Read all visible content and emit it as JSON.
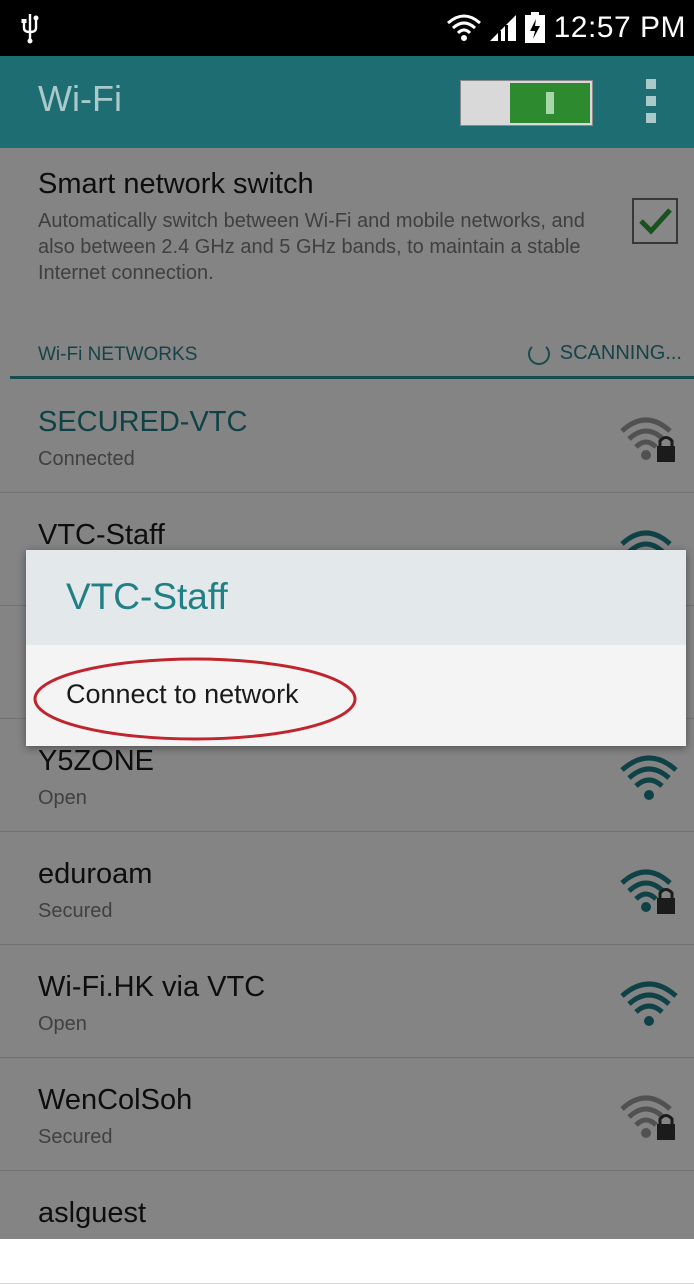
{
  "status_bar": {
    "time": "12:57 PM",
    "icons": [
      "usb-icon",
      "wifi-icon",
      "cell-signal-icon",
      "battery-charging-icon"
    ]
  },
  "action_bar": {
    "title": "Wi-Fi",
    "toggle_state": "on",
    "menu_icon": "overflow-menu-icon"
  },
  "smart_switch": {
    "title": "Smart network switch",
    "description": "Automatically switch between Wi-Fi and mobile networks, and also between 2.4 GHz and 5 GHz bands, to maintain a stable Internet connection.",
    "checked": true
  },
  "networks_section": {
    "label": "Wi-Fi NETWORKS",
    "status": "SCANNING..."
  },
  "networks": [
    {
      "name": "SECURED-VTC",
      "status": "Connected",
      "secured": true,
      "connected": true
    },
    {
      "name": "VTC-Staff",
      "status": "",
      "secured": true,
      "connected": false
    },
    {
      "name": "",
      "status": "",
      "secured": false,
      "connected": false
    },
    {
      "name": "Y5ZONE",
      "status": "Open",
      "secured": false,
      "connected": false
    },
    {
      "name": "eduroam",
      "status": "Secured",
      "secured": true,
      "connected": false
    },
    {
      "name": "Wi-Fi.HK via VTC",
      "status": "Open",
      "secured": false,
      "connected": false
    },
    {
      "name": "WenColSoh",
      "status": "Secured",
      "secured": true,
      "connected": false
    },
    {
      "name": "aslguest",
      "status": "",
      "secured": false,
      "connected": false
    }
  ],
  "dialog": {
    "title": "VTC-Staff",
    "option": "Connect to network"
  },
  "colors": {
    "accent": "#1e6d73",
    "status_bar": "#000000",
    "toggle_on": "#2e8a2e",
    "highlight": "#c0252e"
  }
}
